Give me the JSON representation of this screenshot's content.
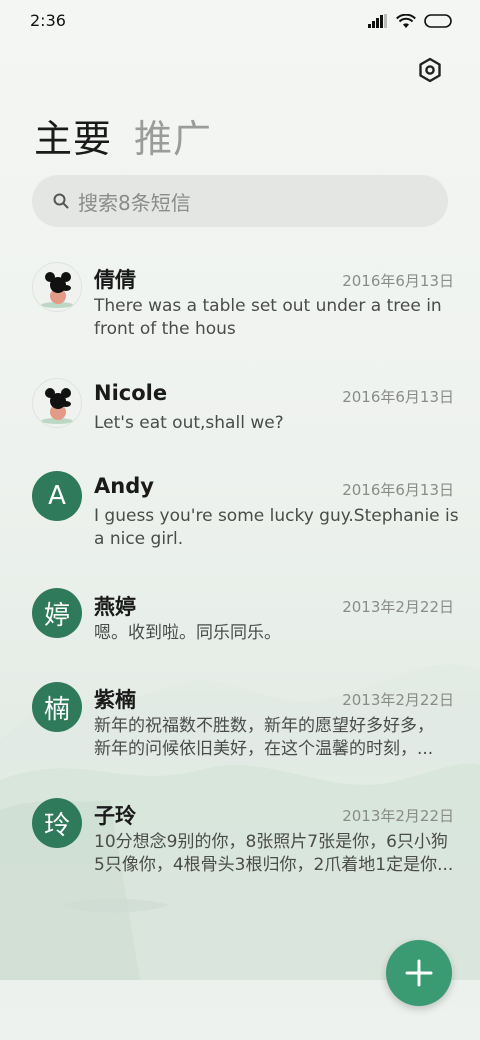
{
  "status_bar": {
    "time": "2:36"
  },
  "tabs": [
    {
      "label": "主要",
      "active": true
    },
    {
      "label": "推广",
      "active": false
    }
  ],
  "search": {
    "placeholder": "搜索8条短信"
  },
  "conversations": [
    {
      "name": "倩倩",
      "date": "2016年6月13日",
      "avatar": "mickey-avatar-icon",
      "lines": [
        "There was a table set out under a tree in",
        "front of the hous"
      ]
    },
    {
      "name": "Nicole",
      "date": "2016年6月13日",
      "avatar": "mickey-avatar-icon",
      "lines": [
        "Let's eat out,shall we?"
      ]
    },
    {
      "name": "Andy",
      "date": "2016年6月13日",
      "avatar_letter": "A",
      "lines": [
        "I guess you're some lucky guy.Stephanie is",
        "a nice girl."
      ]
    },
    {
      "name": "燕婷",
      "date": "2013年2月22日",
      "avatar_letter": "婷",
      "lines": [
        "嗯。收到啦。同乐同乐。"
      ]
    },
    {
      "name": "紫楠",
      "date": "2013年2月22日",
      "avatar_letter": "楠",
      "lines": [
        "新年的祝福数不胜数，新年的愿望好多好多，",
        "新年的问候依旧美好，在这个温馨的时刻，..."
      ]
    },
    {
      "name": "子玲",
      "date": "2013年2月22日",
      "avatar_letter": "玲",
      "lines": [
        "10分想念9别的你，8张照片7张是你，6只小狗",
        "5只像你，4根骨头3根归你，2爪着地1定是你..."
      ]
    }
  ],
  "colors": {
    "accent": "#3a9a72",
    "avatar_green": "#2f7a5a"
  },
  "fab": {
    "icon": "plus-icon"
  }
}
